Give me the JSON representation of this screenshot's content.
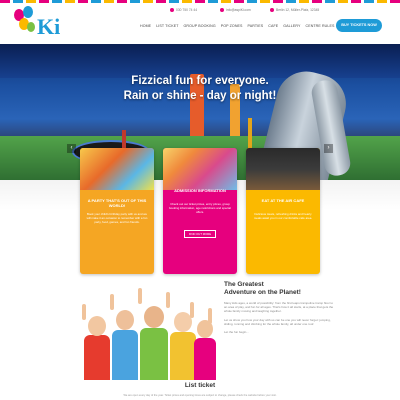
{
  "header": {
    "contact_phone": "030 750 74 44",
    "contact_email": "info@aspiKi.com",
    "contact_address": "Berlin 12, Müller-Platz, 12345",
    "nav_items": [
      "Home",
      "List ticket",
      "Group booking",
      "Pop zones",
      "Parties",
      "Cafe",
      "Gallery",
      "Centre rules",
      "Contact"
    ],
    "cta_label": "Buy tickets now",
    "logo_text": "Ki"
  },
  "hero": {
    "headline_line1": "Fizzical fun for everyone.",
    "headline_line2": "Rain or shine - day or night!",
    "prev_arrow": "‹",
    "next_arrow": "›"
  },
  "cards": [
    {
      "title": "A party that's out of this world!",
      "text": "Book your child's birthday party with us and we will make it an occasion to remember with a fun party, food, games, and fun friends.",
      "color": "#f5a623"
    },
    {
      "title": "Admission information",
      "text": "Check out our ticket prices, entry prices, group booking information, age restrictions and special offers.",
      "button": "Find out more",
      "color": "#e6007e"
    },
    {
      "title": "Eat at the Air Cafe",
      "text": "Delicious treats, refreshing drinks and hearty meals await you in our comfortable cafe area.",
      "color": "#fbb900"
    }
  ],
  "about": {
    "heading_line1": "The Greatest",
    "heading_line2": "Adventure on the Planet!",
    "p1": "Many kids ages, a world of possibility: from the first leaps trampoline tramp floor to an area of play, and fun for all ages. That's how it all starts, at a place that gets the whole family moving and laughing together.",
    "p2": "Let us show you how your day with us can be one you will never forget: jumping, sliding, running and climbing for the whole family, all under one roof.",
    "p3": "Let the fun begin..."
  },
  "list_ticket": {
    "heading": "List ticket",
    "text": "We are open every day of the year. Ticket prices and opening times are subject to change, please check the website before your visit."
  },
  "colors": {
    "magenta": "#e6007e",
    "blue": "#1e9bd7",
    "orange": "#f5a623",
    "yellow": "#fbb900"
  },
  "icons": [
    "phone-icon",
    "email-icon",
    "location-icon",
    "balloon-icon"
  ]
}
